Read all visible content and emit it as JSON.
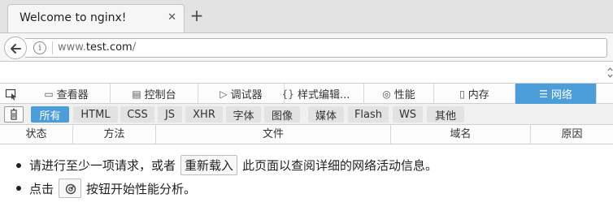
{
  "browser": {
    "tab_title": "Welcome to nginx!",
    "tab_close": "✕",
    "new_tab": "+",
    "url_prefix": "www.",
    "url_host": "test.com",
    "url_suffix": "/"
  },
  "devtools": {
    "tabs": [
      {
        "icon": "▭",
        "label": "查看器"
      },
      {
        "icon": "▤",
        "label": "控制台"
      },
      {
        "icon": "▷",
        "label": "调试器"
      },
      {
        "icon": "{}",
        "label": "样式编辑..."
      },
      {
        "icon": "◎",
        "label": "性能"
      },
      {
        "icon": "▯",
        "label": "内存"
      },
      {
        "icon": "☰",
        "label": "网络"
      }
    ],
    "active_tab": "网络",
    "filters": [
      "所有",
      "HTML",
      "CSS",
      "JS",
      "XHR",
      "字体",
      "图像",
      "媒体",
      "Flash",
      "WS",
      "其他"
    ],
    "active_filter": "所有",
    "columns": [
      "状态",
      "方法",
      "文件",
      "域名",
      "原因"
    ],
    "notice": {
      "line1_before": "请进行至少一项请求，或者",
      "reload_label": "重新载入",
      "line1_after": "此页面以查阅详细的网络活动信息。",
      "line2_before": "点击",
      "line2_after": "按钮开始性能分析。"
    }
  },
  "colors": {
    "accent": "#4c9ed9",
    "toolbar_bg": "#fcfcfc",
    "filter_bg": "#e2e2e2"
  }
}
